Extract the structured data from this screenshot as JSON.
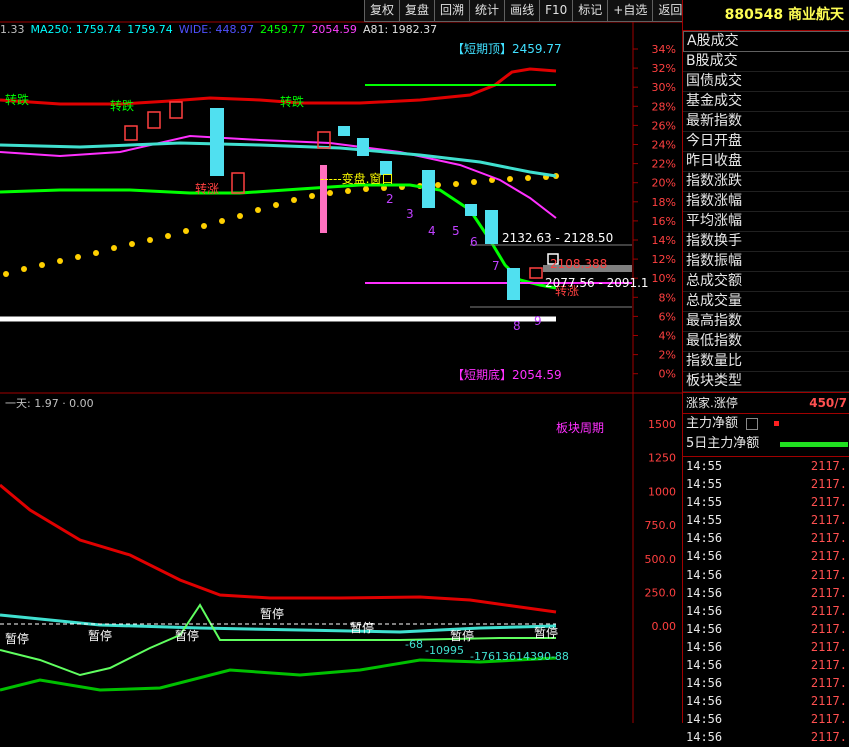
{
  "toolbar": [
    "复权",
    "复盘",
    "回溯",
    "统计",
    "画线",
    "F10",
    "标记",
    "+自选",
    "返回"
  ],
  "ma_legend": [
    {
      "text": "1.33",
      "color": "#c0c0c0"
    },
    {
      "text": "MA250: 1759.74",
      "color": "#00ffff"
    },
    {
      "text": "1759.74",
      "color": "#00ffff"
    },
    {
      "text": "WIDE: 448.97",
      "color": "#5050ff"
    },
    {
      "text": "2459.77",
      "color": "#00ff00"
    },
    {
      "text": "2054.59",
      "color": "#ff40ff"
    },
    {
      "text": "A81: 1982.37",
      "color": "#e0e0e0"
    }
  ],
  "stock": {
    "code": "880548",
    "name": "商业航天"
  },
  "menu": [
    "A股成交",
    "B股成交",
    "国债成交",
    "基金成交",
    "最新指数",
    "今日开盘",
    "昨日收盘",
    "指数涨跌",
    "指数涨幅",
    "平均涨幅",
    "指数换手",
    "指数振幅",
    "总成交额",
    "总成交量",
    "最高指数",
    "最低指数",
    "指数量比",
    "板块类型"
  ],
  "rise_label": "涨家.涨停",
  "rise_value": "450/7",
  "flow": [
    "主力净额",
    "5日主力净额"
  ],
  "ticks": [
    {
      "t": "14:55",
      "p": "2117."
    },
    {
      "t": "14:55",
      "p": "2117."
    },
    {
      "t": "14:55",
      "p": "2117."
    },
    {
      "t": "14:55",
      "p": "2117."
    },
    {
      "t": "14:56",
      "p": "2117."
    },
    {
      "t": "14:56",
      "p": "2117."
    },
    {
      "t": "14:56",
      "p": "2117."
    },
    {
      "t": "14:56",
      "p": "2117."
    },
    {
      "t": "14:56",
      "p": "2117."
    },
    {
      "t": "14:56",
      "p": "2117."
    },
    {
      "t": "14:56",
      "p": "2117."
    },
    {
      "t": "14:56",
      "p": "2117."
    },
    {
      "t": "14:56",
      "p": "2117."
    },
    {
      "t": "14:56",
      "p": "2117."
    },
    {
      "t": "14:56",
      "p": "2117."
    },
    {
      "t": "14:56",
      "p": "2117."
    }
  ],
  "upper_axis": [
    "34%",
    "32%",
    "30%",
    "28%",
    "26%",
    "24%",
    "22%",
    "20%",
    "18%",
    "16%",
    "14%",
    "12%",
    "10%",
    "8%",
    "6%",
    "4%",
    "2%",
    "0%"
  ],
  "lower_axis": [
    "1500",
    "1250",
    "1000",
    "750.0",
    "500.0",
    "250.0",
    "0.00"
  ],
  "annotations": {
    "short_top": "【短期顶】2459.77",
    "short_bottom": "【短期底】2054.59",
    "range1": "2132.63 - 2128.50",
    "range2": "2077.56 - 2091.1",
    "price_box": "2108.388",
    "change_window": "-----变盘.窗口",
    "sector_cycle": "板块周期",
    "lower_legend": "一天: 1.97 · 0.00",
    "wave_labels": [
      "2",
      "3",
      "4",
      "5",
      "6",
      "7",
      "8",
      "9"
    ]
  },
  "colors": {
    "red": "#e00000",
    "green": "#00ff00",
    "cyan": "#40e0d0",
    "magenta": "#ff30ff",
    "yellow": "#ffd000"
  }
}
